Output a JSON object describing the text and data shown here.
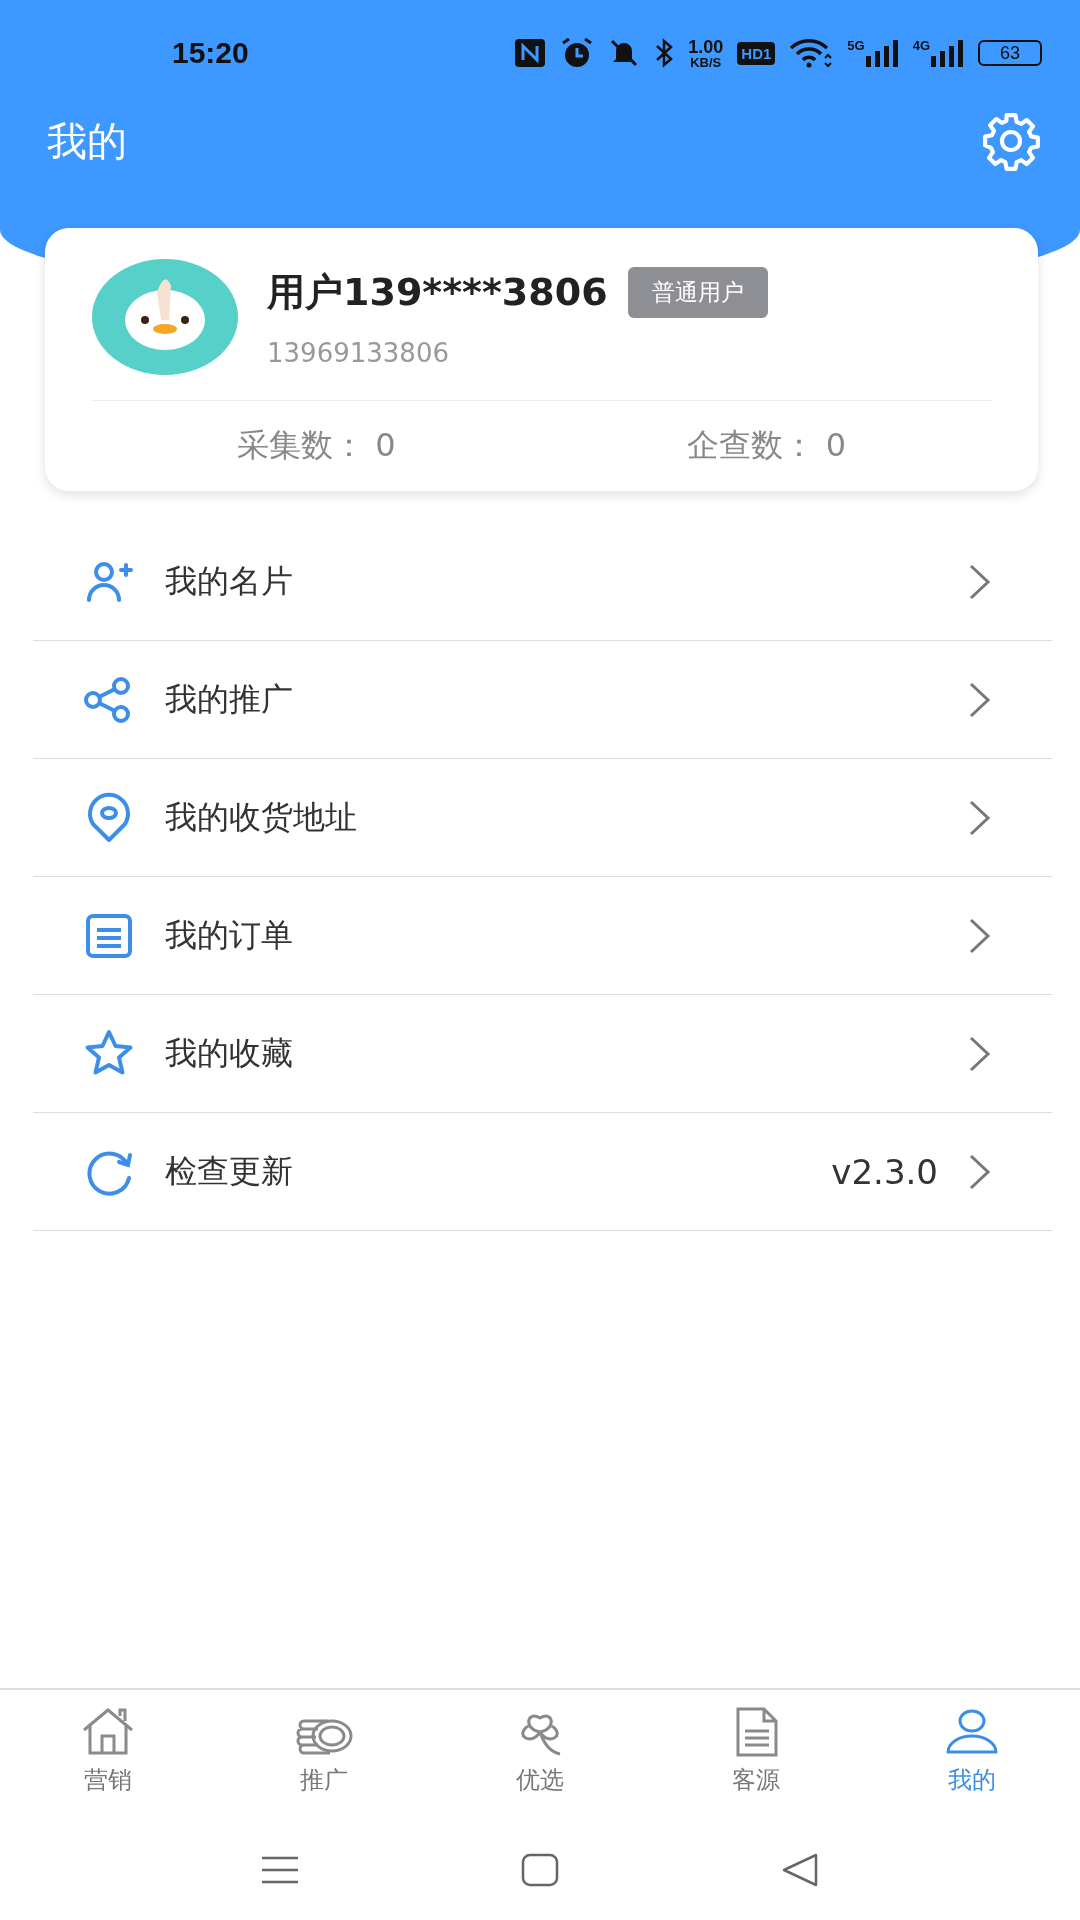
{
  "status_bar": {
    "time": "15:20",
    "speed_value": "1.00",
    "speed_unit": "KB/S",
    "hd_label": "HD1",
    "network_5g": "5G",
    "network_4g": "4G",
    "battery": "63"
  },
  "header": {
    "title": "我的"
  },
  "profile": {
    "name": "用户139****3806",
    "badge": "普通用户",
    "phone": "13969133806",
    "stats": [
      {
        "label": "采集数：",
        "value": "0"
      },
      {
        "label": "企查数：",
        "value": "0"
      }
    ]
  },
  "menu": [
    {
      "label": "我的名片"
    },
    {
      "label": "我的推广"
    },
    {
      "label": "我的收货地址"
    },
    {
      "label": "我的订单"
    },
    {
      "label": "我的收藏"
    },
    {
      "label": "检查更新",
      "value": "v2.3.0"
    }
  ],
  "tabs": [
    {
      "label": "营销",
      "selected": false
    },
    {
      "label": "推广",
      "selected": false
    },
    {
      "label": "优选",
      "selected": false
    },
    {
      "label": "客源",
      "selected": false
    },
    {
      "label": "我的",
      "selected": true
    }
  ]
}
